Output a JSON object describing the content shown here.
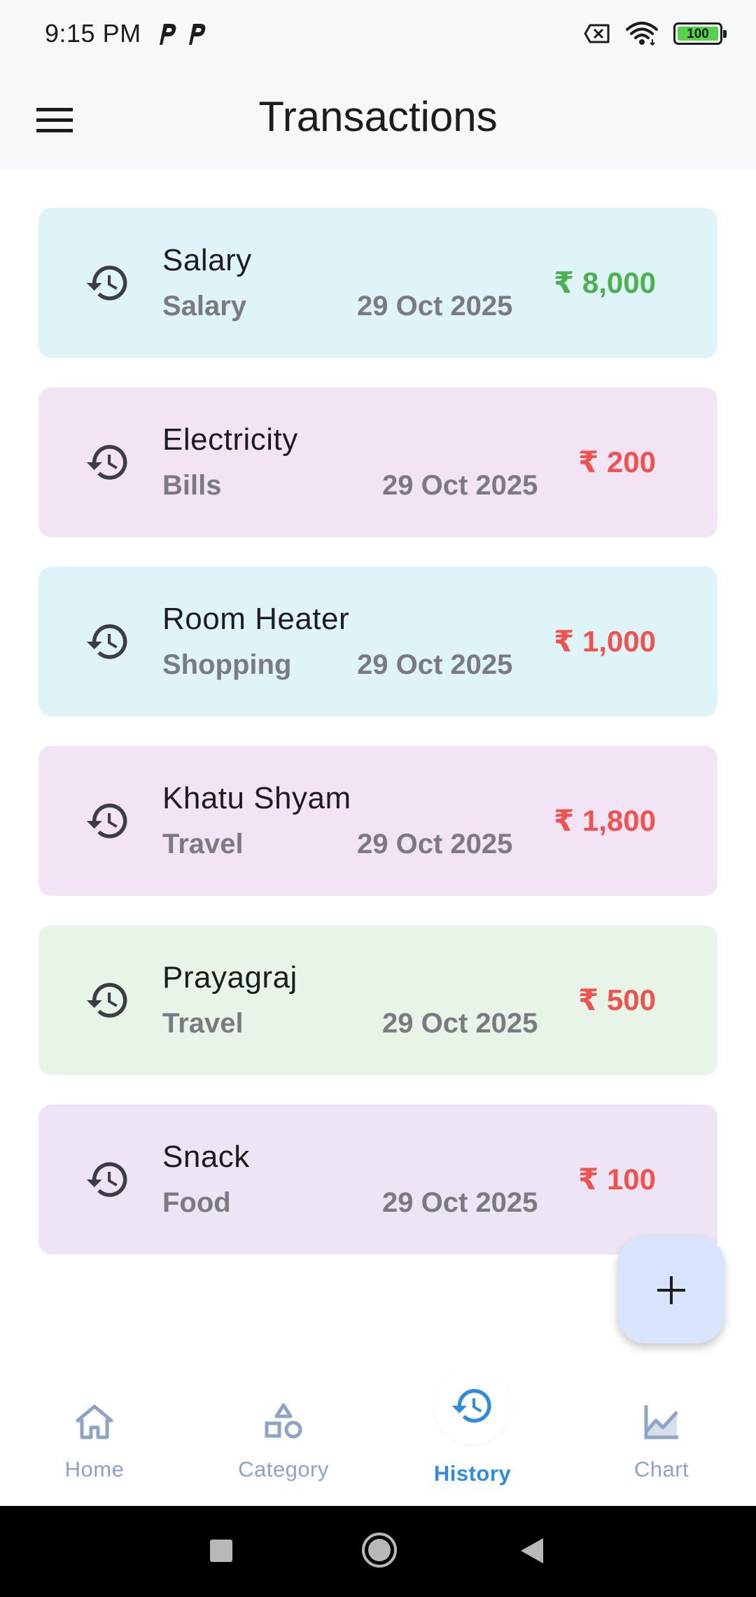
{
  "status_bar": {
    "time": "9:15 PM",
    "notification_icons": [
      "p-app-icon",
      "p-app-icon"
    ],
    "battery_level": "100",
    "system_icons": [
      "sim-off-icon",
      "wifi-icon",
      "battery-icon"
    ]
  },
  "app_bar": {
    "title": "Transactions",
    "menu_icon": "hamburger-menu-icon"
  },
  "transactions": [
    {
      "title": "Salary",
      "category": "Salary",
      "date": "29 Oct 2025",
      "amount": "₹ 8,000",
      "type": "income",
      "bg": "#dff4f8",
      "amount_color": "#4caf50"
    },
    {
      "title": "Electricity",
      "category": "Bills",
      "date": "29 Oct 2025",
      "amount": "₹ 200",
      "type": "expense",
      "bg": "#f2e4f5",
      "amount_color": "#ef5350"
    },
    {
      "title": "Room Heater",
      "category": "Shopping",
      "date": "29 Oct 2025",
      "amount": "₹ 1,000",
      "type": "expense",
      "bg": "#dff4f8",
      "amount_color": "#ef5350"
    },
    {
      "title": "Khatu Shyam",
      "category": "Travel",
      "date": "29 Oct 2025",
      "amount": "₹ 1,800",
      "type": "expense",
      "bg": "#f2e4f5",
      "amount_color": "#ef5350"
    },
    {
      "title": "Prayagraj",
      "category": "Travel",
      "date": "29 Oct 2025",
      "amount": "₹ 500",
      "type": "expense",
      "bg": "#e8f4e7",
      "amount_color": "#ef5350"
    },
    {
      "title": "Snack",
      "category": "Food",
      "date": "29 Oct 2025",
      "amount": "₹ 100",
      "type": "expense",
      "bg": "#ede4f5",
      "amount_color": "#ef5350"
    }
  ],
  "fab": {
    "icon": "plus-icon"
  },
  "bottom_nav": {
    "items": [
      {
        "label": "Home",
        "icon": "home-icon",
        "active": false
      },
      {
        "label": "Category",
        "icon": "shapes-icon",
        "active": false
      },
      {
        "label": "History",
        "icon": "history-icon",
        "active": true
      },
      {
        "label": "Chart",
        "icon": "chart-icon",
        "active": false
      }
    ]
  },
  "colors": {
    "accent": "#2f8be0",
    "inactive": "#8fa3c7",
    "income": "#4caf50",
    "expense": "#ef5350",
    "fab_bg": "#d8e4fb"
  }
}
